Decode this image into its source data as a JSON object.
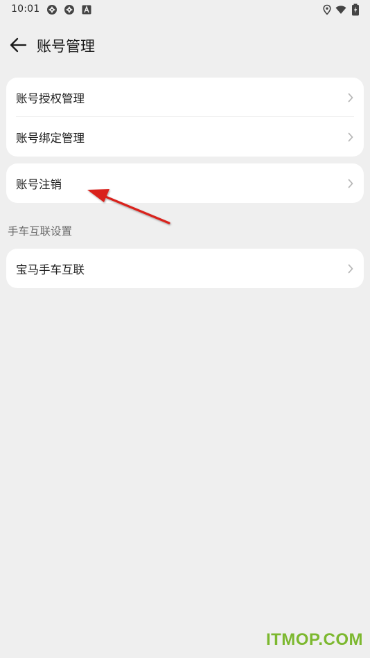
{
  "status_bar": {
    "time": "10:01",
    "left_icons": [
      "sync-icon",
      "sync-icon",
      "font-a-icon"
    ],
    "right_icons": [
      "location-icon",
      "wifi-icon",
      "battery-charging-icon"
    ]
  },
  "header": {
    "back_icon": "arrow-left-icon",
    "title": "账号管理"
  },
  "group1": {
    "items": [
      {
        "label": "账号授权管理",
        "icon": "chevron-right-icon"
      },
      {
        "label": "账号绑定管理",
        "icon": "chevron-right-icon"
      }
    ]
  },
  "group2": {
    "items": [
      {
        "label": "账号注销",
        "icon": "chevron-right-icon"
      }
    ]
  },
  "section": {
    "title": "手车互联设置"
  },
  "group3": {
    "items": [
      {
        "label": "宝马手车互联",
        "icon": "chevron-right-icon"
      }
    ]
  },
  "annotation": {
    "color": "#d9231e",
    "icon": "red-arrow-annotation"
  },
  "watermark": {
    "text": "ITMOP.COM",
    "color": "#7cb82f"
  },
  "colors": {
    "background": "#efefef",
    "card": "#ffffff",
    "chevron": "#b8b8b8"
  }
}
